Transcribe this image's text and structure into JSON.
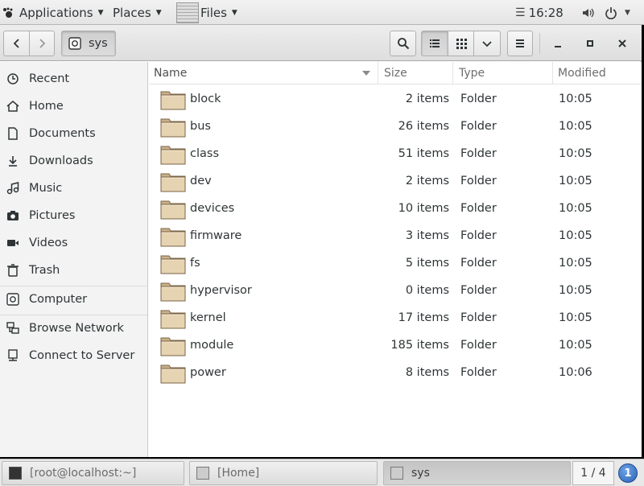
{
  "top_panel": {
    "applications": "Applications",
    "places": "Places",
    "files": "Files",
    "time": "16:28"
  },
  "headerbar": {
    "path_button": "sys"
  },
  "sidebar": {
    "items": [
      {
        "label": "Recent",
        "icon": "clock-icon"
      },
      {
        "label": "Home",
        "icon": "home-icon"
      },
      {
        "label": "Documents",
        "icon": "document-icon"
      },
      {
        "label": "Downloads",
        "icon": "download-icon"
      },
      {
        "label": "Music",
        "icon": "music-icon"
      },
      {
        "label": "Pictures",
        "icon": "camera-icon"
      },
      {
        "label": "Videos",
        "icon": "video-icon"
      },
      {
        "label": "Trash",
        "icon": "trash-icon"
      },
      {
        "label": "Computer",
        "icon": "computer-icon"
      },
      {
        "label": "Browse Network",
        "icon": "network-icon"
      },
      {
        "label": "Connect to Server",
        "icon": "server-icon"
      }
    ]
  },
  "columns": {
    "name": "Name",
    "size": "Size",
    "type": "Type",
    "modified": "Modified"
  },
  "files": [
    {
      "name": "block",
      "size": "2 items",
      "type": "Folder",
      "modified": "10:05"
    },
    {
      "name": "bus",
      "size": "26 items",
      "type": "Folder",
      "modified": "10:05"
    },
    {
      "name": "class",
      "size": "51 items",
      "type": "Folder",
      "modified": "10:05"
    },
    {
      "name": "dev",
      "size": "2 items",
      "type": "Folder",
      "modified": "10:05"
    },
    {
      "name": "devices",
      "size": "10 items",
      "type": "Folder",
      "modified": "10:05"
    },
    {
      "name": "firmware",
      "size": "3 items",
      "type": "Folder",
      "modified": "10:05"
    },
    {
      "name": "fs",
      "size": "5 items",
      "type": "Folder",
      "modified": "10:05"
    },
    {
      "name": "hypervisor",
      "size": "0 items",
      "type": "Folder",
      "modified": "10:05"
    },
    {
      "name": "kernel",
      "size": "17 items",
      "type": "Folder",
      "modified": "10:05"
    },
    {
      "name": "module",
      "size": "185 items",
      "type": "Folder",
      "modified": "10:05"
    },
    {
      "name": "power",
      "size": "8 items",
      "type": "Folder",
      "modified": "10:06"
    }
  ],
  "taskbar": {
    "tasks": [
      {
        "label": "[root@localhost:~]"
      },
      {
        "label": "[Home]"
      },
      {
        "label": "sys"
      }
    ],
    "workspace": "1 / 4",
    "notifications": "1"
  }
}
